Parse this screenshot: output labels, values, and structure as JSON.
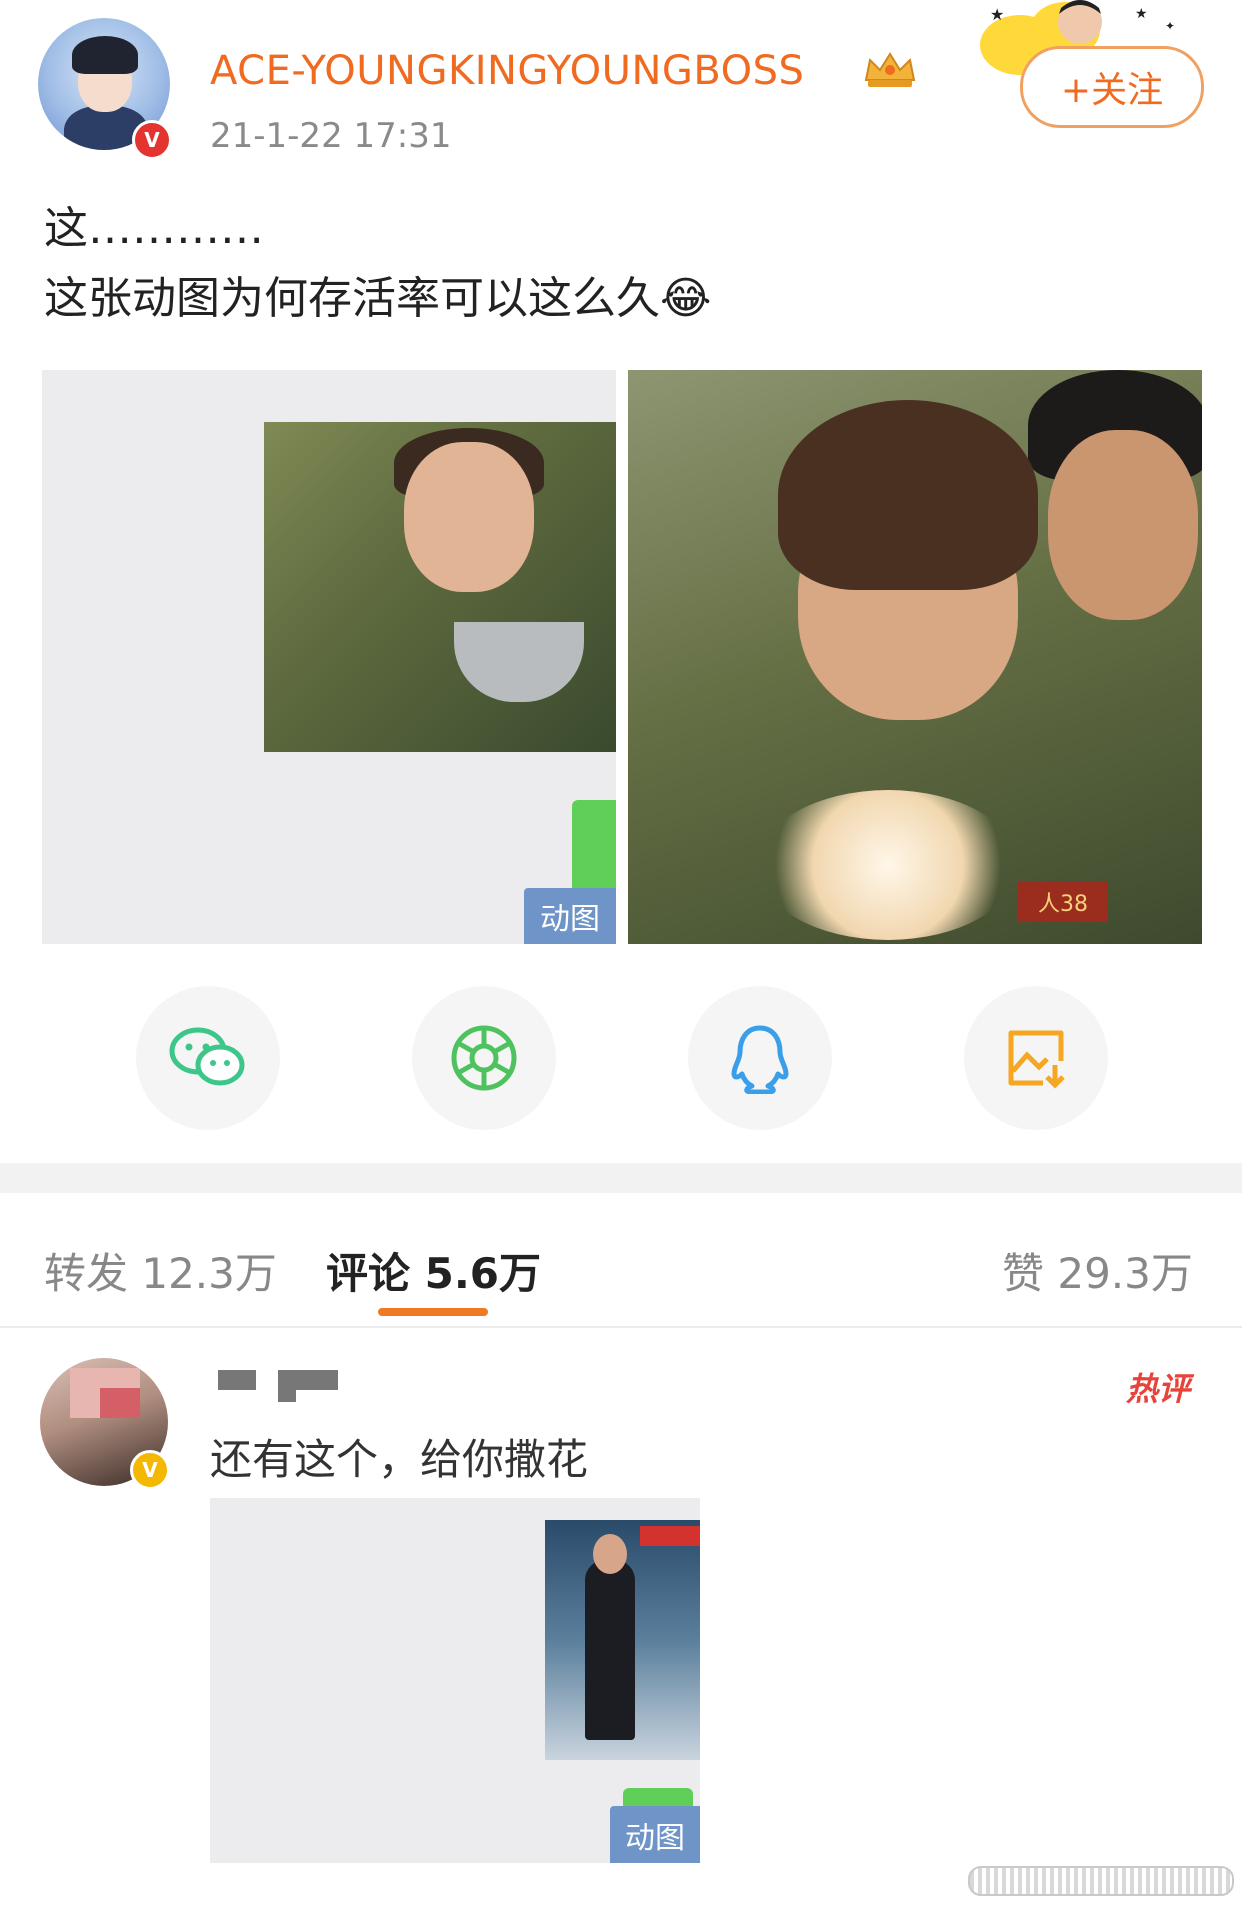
{
  "post": {
    "username": "ACE-YOUNGKINGYOUNGBOSS",
    "timestamp": "21-1-22 17:31",
    "follow_label": "+关注",
    "text_line1": "这…………",
    "text_line2": "这张动图为何存活率可以这么久",
    "emoji": "😂",
    "images": [
      {
        "tag": "动图"
      },
      {
        "tag": ""
      }
    ]
  },
  "share": [
    {
      "icon": "wechat-icon"
    },
    {
      "icon": "moments-icon"
    },
    {
      "icon": "qq-icon"
    },
    {
      "icon": "save-image-icon"
    }
  ],
  "tabs": {
    "repost": "转发 12.3万",
    "comments": "评论 5.6万",
    "likes": "赞 29.3万"
  },
  "comment": {
    "text": "还有这个，给你撒花",
    "hot_badge": "热评",
    "image_tag": "动图"
  },
  "colors": {
    "username": "#f06a20",
    "accent": "#f07a22",
    "gif_tag_bg": "#6f95c8",
    "hot": "#e8433a"
  }
}
